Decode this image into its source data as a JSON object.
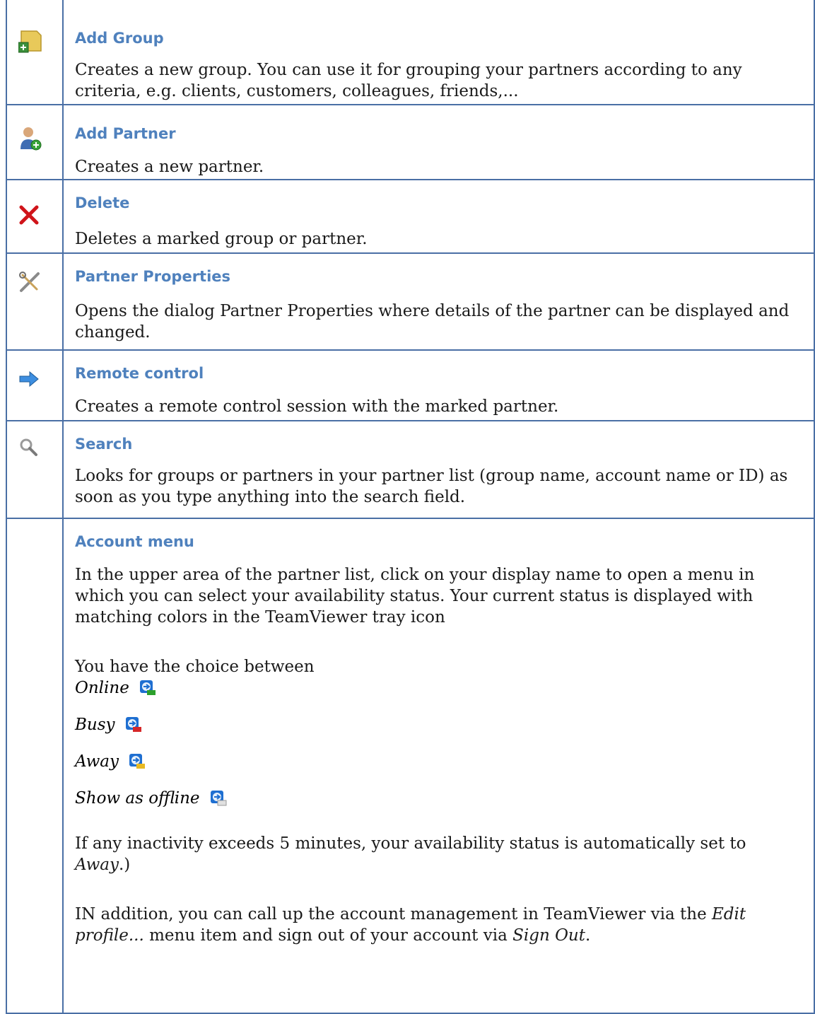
{
  "rows": [
    {
      "title": "Add Group",
      "icon": "add-group-icon",
      "text": "Creates a new group. You can use it for grouping your partners according to any criteria, e.g. clients, customers, colleagues, friends,..."
    },
    {
      "title": "Add Partner",
      "icon": "add-partner-icon",
      "text": "Creates a new partner."
    },
    {
      "title": "Delete",
      "icon": "delete-icon",
      "text": "Deletes a marked group or partner."
    },
    {
      "title": "Partner Properties",
      "icon": "properties-icon",
      "text": "Opens the dialog Partner Properties where details of the partner can be displayed and changed."
    },
    {
      "title": "Remote control",
      "icon": "arrow-right-icon",
      "text": "Creates a remote control session with the marked partner."
    },
    {
      "title": "Search",
      "icon": "search-icon",
      "text": "Looks for groups or partners in your partner list (group name, account name or ID) as soon as you type anything into the search field."
    }
  ],
  "account": {
    "title": "Account menu",
    "intro": "In the upper area of the partner list, click on your display name to open a menu in which you can select your availability status. Your current status is displayed with matching colors in the TeamViewer tray icon",
    "choice_intro": "You have the choice between",
    "statuses": [
      {
        "label": "Online",
        "color": "#2ca02c"
      },
      {
        "label": "Busy",
        "color": "#d62728"
      },
      {
        "label": "Away",
        "color": "#e8b923"
      },
      {
        "label": "Show as offline",
        "color": "#e0e0e0"
      }
    ],
    "inactivity_prefix": "If any inactivity exceeds 5 minutes, your availability status is automatically set to ",
    "inactivity_status": "Away",
    "inactivity_suffix": ".)",
    "addition_prefix": "IN addition, you can call up the account management in TeamViewer via the ",
    "addition_edit": "Edit profile...",
    "addition_mid": " menu item and sign out of your account via ",
    "addition_signout": "Sign Out",
    "addition_suffix": "."
  }
}
